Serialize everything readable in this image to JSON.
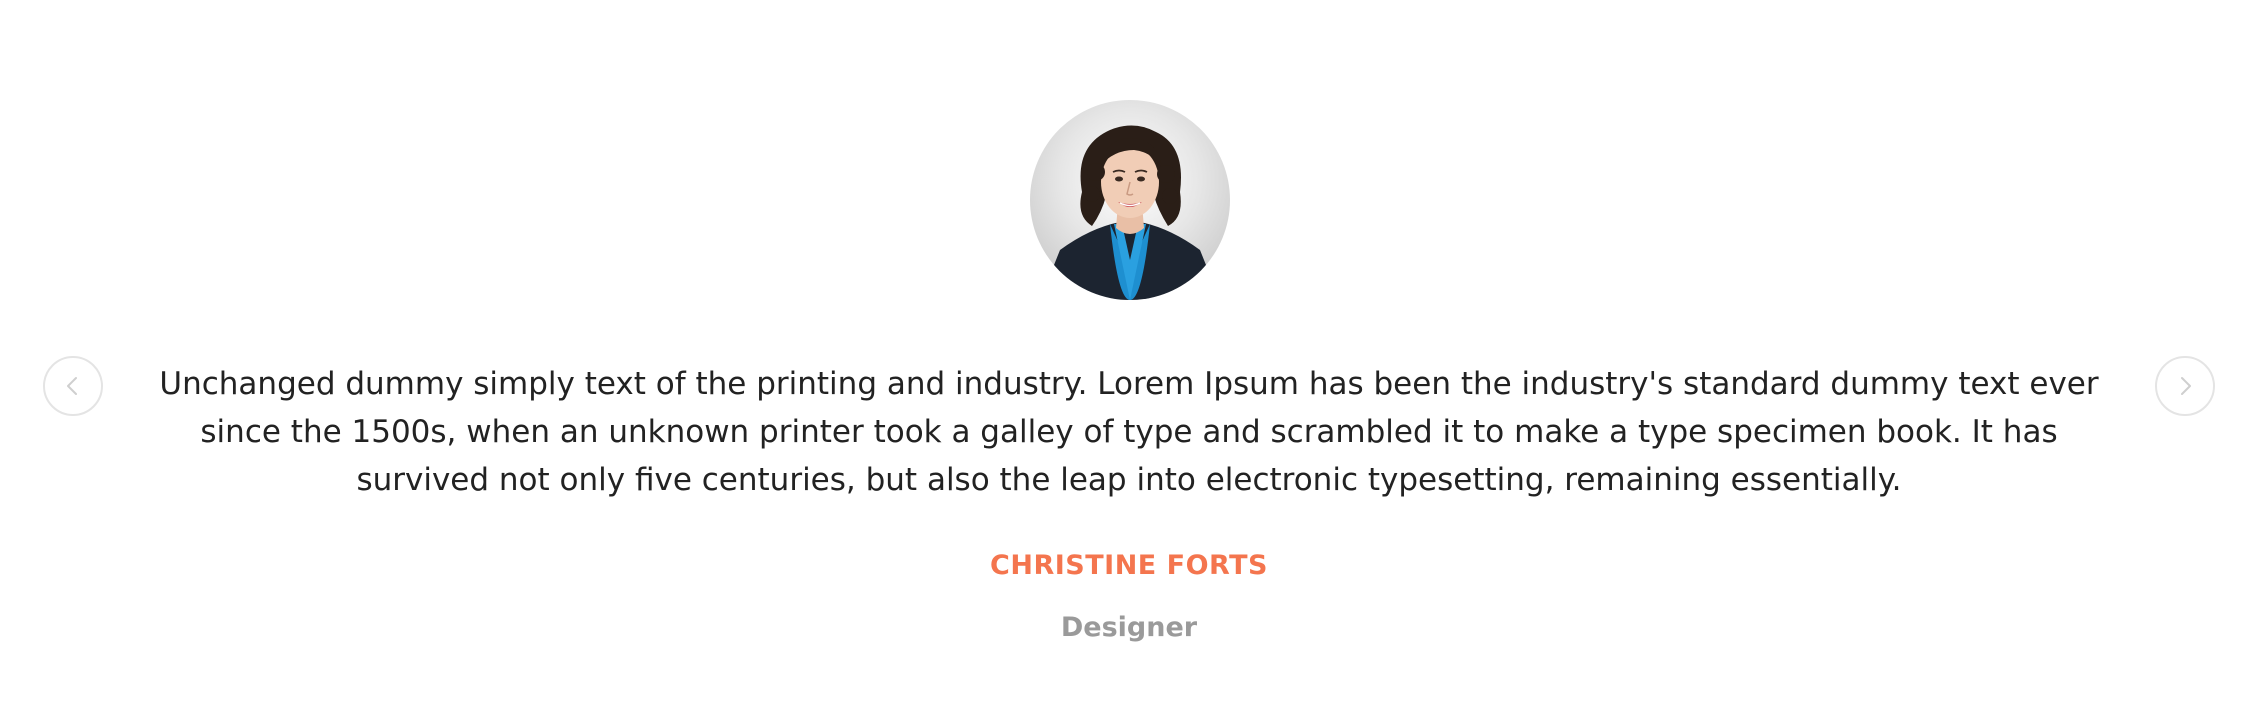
{
  "testimonial": {
    "avatar_icon": "person-portrait",
    "quote": "Unchanged dummy simply text of the printing and industry. Lorem Ipsum has been the industry's standard dummy text ever since the 1500s, when an unknown printer took a galley of type and scrambled it to make a type specimen book. It has survived not only five centuries, but also the leap into electronic typesetting, remaining essentially.",
    "author": {
      "name": "CHRISTINE FORTS",
      "role": "Designer"
    }
  },
  "navigation": {
    "prev_icon": "chevron-left-icon",
    "next_icon": "chevron-right-icon"
  },
  "colors": {
    "accent": "#f4754e",
    "role_text": "#9a9a9a",
    "body_text": "#222222",
    "nav_border": "#e4e4e4"
  }
}
